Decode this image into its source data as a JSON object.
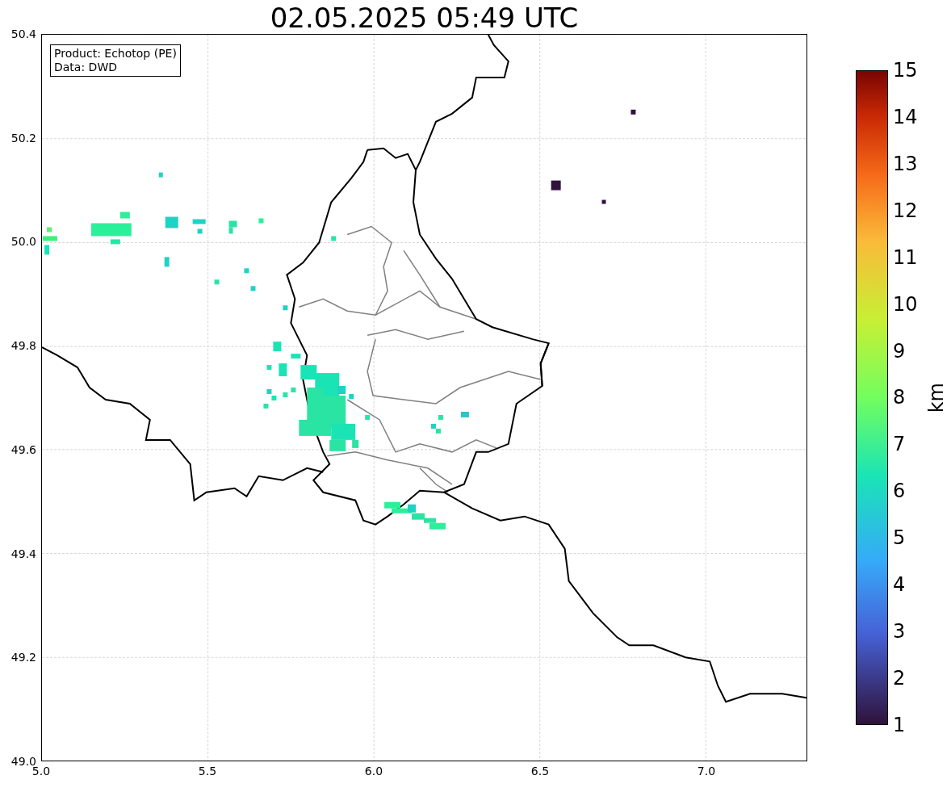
{
  "title": "02.05.2025 05:49 UTC",
  "info_box": [
    "Product: Echotop (PE)",
    "Data: DWD"
  ],
  "y_ticks": [
    "50.4",
    "50.2",
    "50.0",
    "49.8",
    "49.6",
    "49.4",
    "49.2",
    "49.0"
  ],
  "x_ticks": [
    "5.0",
    "5.5",
    "6.0",
    "6.5",
    "7.0"
  ],
  "colorbar": {
    "label": "km",
    "ticks": [
      "15",
      "14",
      "13",
      "12",
      "11",
      "10",
      "9",
      "8",
      "7",
      "6",
      "5",
      "4",
      "3",
      "2",
      "1"
    ]
  }
}
